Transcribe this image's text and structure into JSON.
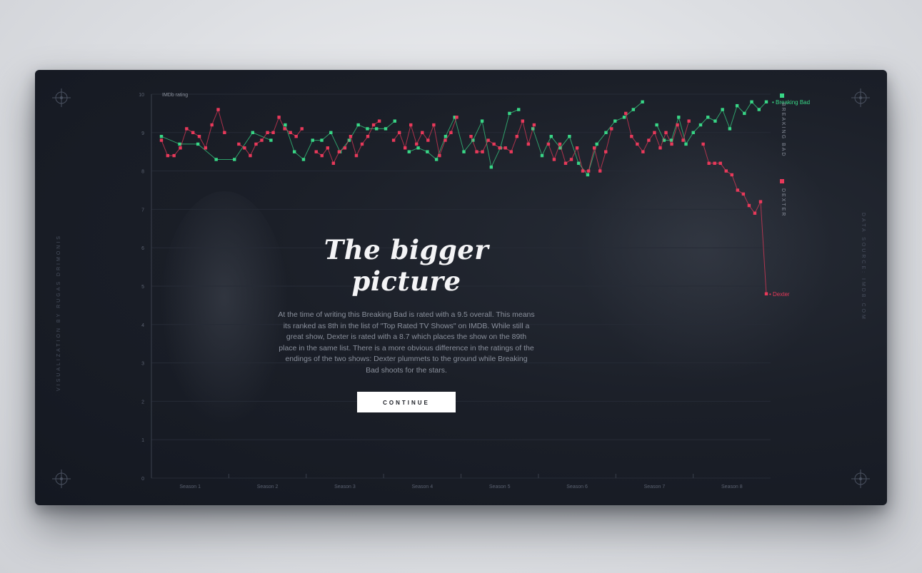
{
  "page": {
    "title": "The bigger picture",
    "body": "At the time of writing this Breaking Bad is rated with a 9.5 overall. This means its ranked as 8th in the list of \"Top Rated TV Shows\" on IMDB. While still a great show, Dexter is rated with a 8.7 which places the show on the 89th place in the same list. There is a more obvious difference in the ratings of the endings of the two shows: Dexter plummets to the ground while Breaking Bad shoots for the stars.",
    "continue_label": "CONTINUE",
    "credit_left": "VISUALIZATION BY RUGAS DRIMONIS",
    "credit_right": "DATA SOURCE: IMDB.COM"
  },
  "colors": {
    "breaking_bad": "#38d686",
    "dexter": "#e8395a",
    "axis": "#5a6170",
    "card": "#1b1f28"
  },
  "icons": [
    "crosshair-icon"
  ],
  "chart_data": {
    "type": "line",
    "ylabel": "IMDb rating",
    "ylim": [
      0,
      10
    ],
    "yticks": [
      0,
      1,
      2,
      3,
      4,
      5,
      6,
      7,
      8,
      9,
      10
    ],
    "categories": [
      "Season 1",
      "Season 2",
      "Season 3",
      "Season 4",
      "Season 5",
      "Season 6",
      "Season 7",
      "Season 8"
    ],
    "legend": [
      {
        "name": "BREAKING BAD",
        "color": "#38d686"
      },
      {
        "name": "DEXTER",
        "color": "#e8395a"
      }
    ],
    "series": [
      {
        "name": "Breaking Bad",
        "end_label": "Breaking Bad",
        "color": "#38d686",
        "seasons": [
          [
            8.9,
            8.7,
            8.7,
            8.3,
            8.3,
            9.0,
            8.8
          ],
          [
            9.2,
            8.5,
            8.3,
            8.8,
            8.8,
            9.0,
            8.5,
            8.8,
            9.2,
            9.1,
            9.1,
            9.1,
            9.3
          ],
          [
            8.5,
            8.6,
            8.5,
            8.3,
            8.9,
            9.4,
            8.5,
            8.8,
            9.3,
            8.1,
            8.6,
            9.5,
            9.6
          ],
          [
            9.1,
            8.4,
            8.9,
            8.6,
            8.9,
            8.2,
            7.9,
            8.7,
            9.0,
            9.3,
            9.4,
            9.6,
            9.8
          ],
          [
            9.2,
            8.8,
            8.8,
            9.4,
            8.7,
            9.0,
            9.2,
            9.4,
            9.3,
            9.6,
            9.1,
            9.7,
            9.5,
            9.8,
            9.6,
            9.8
          ]
        ]
      },
      {
        "name": "Dexter",
        "end_label": "Dexter",
        "color": "#e8395a",
        "seasons": [
          [
            8.8,
            8.4,
            8.4,
            8.6,
            9.1,
            9.0,
            8.9,
            8.6,
            9.2,
            9.6,
            9.0
          ],
          [
            8.7,
            8.6,
            8.4,
            8.7,
            8.8,
            9.0,
            9.0,
            9.4,
            9.1,
            9.0,
            8.9,
            9.1
          ],
          [
            8.5,
            8.4,
            8.6,
            8.2,
            8.5,
            8.6,
            8.9,
            8.4,
            8.7,
            8.9,
            9.2,
            9.3
          ],
          [
            8.8,
            9.0,
            8.6,
            9.2,
            8.7,
            9.0,
            8.8,
            9.2,
            8.4,
            8.8,
            9.0,
            9.4
          ],
          [
            8.9,
            8.5,
            8.5,
            8.8,
            8.7,
            8.6,
            8.6,
            8.5,
            8.9,
            9.3,
            8.7,
            9.2
          ],
          [
            8.7,
            8.3,
            8.7,
            8.2,
            8.3,
            8.6,
            8.0,
            8.0,
            8.6,
            8.0,
            8.5,
            9.1
          ],
          [
            9.5,
            8.9,
            8.7,
            8.5,
            8.8,
            9.0,
            8.6,
            9.0,
            8.7,
            9.2,
            8.8,
            9.3
          ],
          [
            8.7,
            8.2,
            8.2,
            8.2,
            8.0,
            7.9,
            7.5,
            7.4,
            7.1,
            6.9,
            7.2,
            4.8
          ]
        ]
      }
    ]
  }
}
